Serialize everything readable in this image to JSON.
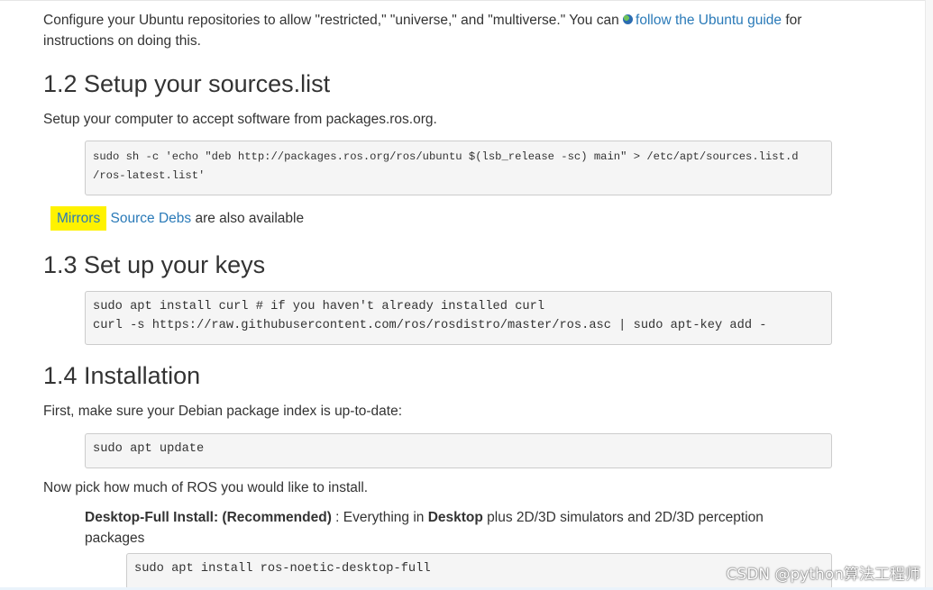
{
  "intro": {
    "text_before": "Configure your Ubuntu repositories to allow \"restricted,\" \"universe,\" and \"multiverse.\" You can ",
    "link": "follow the Ubuntu guide",
    "text_after": " for",
    "line2": "instructions on doing this."
  },
  "s12": {
    "title": "1.2 Setup your sources.list",
    "desc": "Setup your computer to accept software from packages.ros.org.",
    "code_line1": "sudo sh -c 'echo \"deb http://packages.ros.org/ros/ubuntu $(lsb_release -sc) main\" > /etc/apt/sources.list.d",
    "code_line2": "/ros-latest.list'"
  },
  "mirrors": {
    "mirrors_link": "Mirrors",
    "source_debs_link": "Source Debs",
    "text": " are also available"
  },
  "s13": {
    "title": "1.3 Set up your keys",
    "code_line1": "sudo apt install curl # if you haven't already installed curl",
    "code_line2": "curl -s https://raw.githubusercontent.com/ros/rosdistro/master/ros.asc | sudo apt-key add -"
  },
  "s14": {
    "title": "1.4 Installation",
    "desc": "First, make sure your Debian package index is up-to-date:",
    "code": "sudo apt update",
    "pick": "Now pick how much of ROS you would like to install.",
    "desktop_full_bold": "Desktop-Full Install: (Recommended)",
    "desktop_full_mid": " : Everything in ",
    "desktop_bold": "Desktop",
    "desktop_full_rest": " plus 2D/3D simulators and 2D/3D perception",
    "desktop_full_line2": "packages",
    "code_full": "sudo apt install ros-noetic-desktop-full"
  },
  "watermark": "CSDN @python算法工程师",
  "colors": {
    "link": "#2a7ab8",
    "highlight": "#fff200",
    "code_bg": "#f5f5f5"
  }
}
